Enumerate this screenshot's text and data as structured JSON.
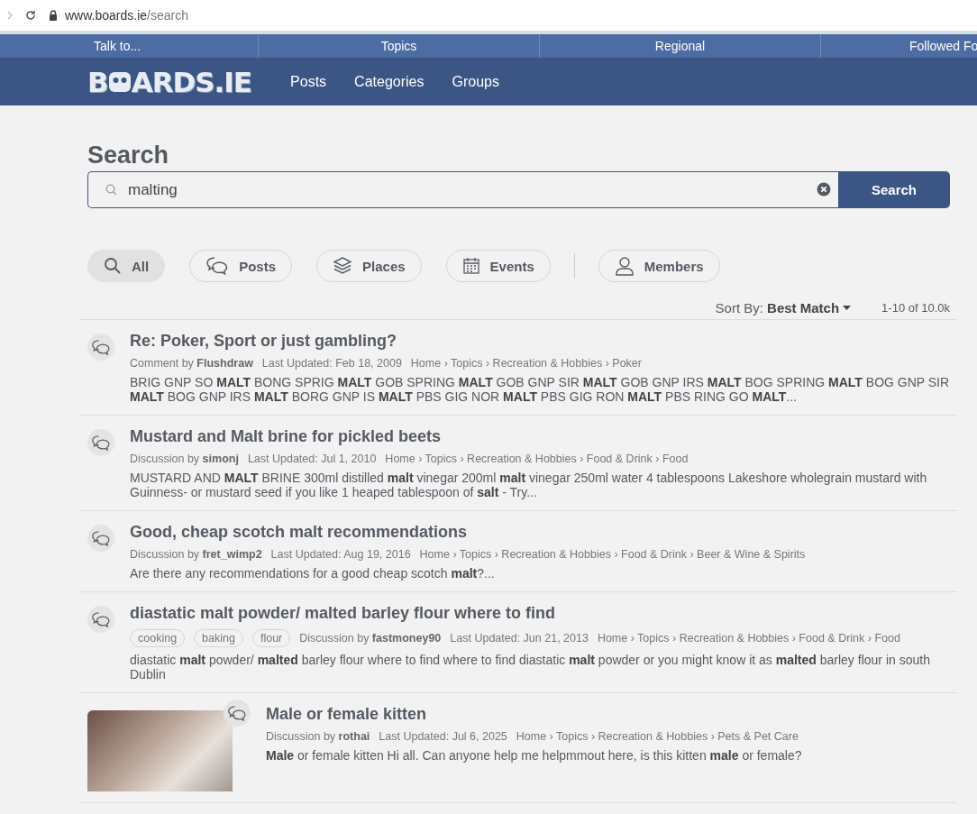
{
  "browser": {
    "url_host": "www.boards.ie",
    "url_path": "/search"
  },
  "top_bar": [
    "Talk to...",
    "Topics",
    "Regional",
    "Followed Fo"
  ],
  "nav": {
    "logo_start": "B",
    "logo_end": "ARDS.IE",
    "items": [
      "Posts",
      "Categories",
      "Groups"
    ]
  },
  "search": {
    "heading": "Search",
    "value": "malting",
    "button": "Search"
  },
  "filters": [
    {
      "label": "All",
      "kind": "all",
      "selected": true
    },
    {
      "label": "Posts",
      "kind": "posts",
      "selected": false
    },
    {
      "label": "Places",
      "kind": "places",
      "selected": false
    },
    {
      "label": "Events",
      "kind": "events",
      "selected": false
    },
    {
      "label": "Members",
      "kind": "members",
      "selected": false
    }
  ],
  "sort": {
    "label": "Sort By:",
    "value": "Best Match",
    "count": "1-10 of 10.0k"
  },
  "results": [
    {
      "title": "Re: Poker, Sport or just gambling?",
      "byline": "Comment by **Flushdraw**",
      "updated": "Last Updated: Feb 18, 2009",
      "breadcrumb": "Home › Topics › Recreation & Hobbies › Poker",
      "excerpt": "BRIG GNP SO **MALT** BONG SPRIG **MALT** GOB SPRING **MALT** GOB GNP SIR **MALT** GOB GNP IRS **MALT** BOG SPRING **MALT** BOG GNP SIR **MALT** BOG GNP IRS **MALT** BORG GNP IS **MALT** PBS GIG NOR **MALT** PBS GIG RON **MALT** PBS RING GO **MALT**...",
      "thumbnail": false
    },
    {
      "title": "Mustard and Malt brine for pickled beets",
      "byline": "Discussion by **simonj**",
      "updated": "Last Updated: Jul 1, 2010",
      "breadcrumb": "Home › Topics › Recreation & Hobbies › Food & Drink › Food",
      "excerpt": "MUSTARD AND **MALT** BRINE 300ml distilled **malt** vinegar 200ml **malt** vinegar 250ml water 4 tablespoons Lakeshore wholegrain mustard with Guinness- or mustard seed if you like 1 heaped tablespoon of **salt** - Try...",
      "thumbnail": false
    },
    {
      "title": "Good, cheap scotch malt recommendations",
      "byline": "Discussion by **fret_wimp2**",
      "updated": "Last Updated: Aug 19, 2016",
      "breadcrumb": "Home › Topics › Recreation & Hobbies › Food & Drink › Beer & Wine & Spirits",
      "excerpt": "Are there any recommendations for a good cheap scotch **malt**?...",
      "thumbnail": false
    },
    {
      "title": "diastatic malt powder/ malted barley flour where to find",
      "tags": [
        "cooking",
        "baking",
        "flour"
      ],
      "byline": "Discussion by **fastmoney90**",
      "updated": "Last Updated: Jun 21, 2013",
      "breadcrumb": "Home › Topics › Recreation & Hobbies › Food & Drink › Food",
      "excerpt": "diastatic **malt** powder/ **malted** barley flour where to find where to find diastatic **malt** powder or you might know it as **malted** barley flour in south Dublin",
      "thumbnail": false
    },
    {
      "title": "Male or female kitten",
      "byline": "Discussion by **rothai**",
      "updated": "Last Updated: Jul 6, 2025",
      "breadcrumb": "Home › Topics › Recreation & Hobbies › Pets & Pet Care",
      "excerpt": "**Male** or female kitten Hi all. Can anyone help me helpmmout here, is this kitten **male** or female?",
      "thumbnail": true
    }
  ]
}
